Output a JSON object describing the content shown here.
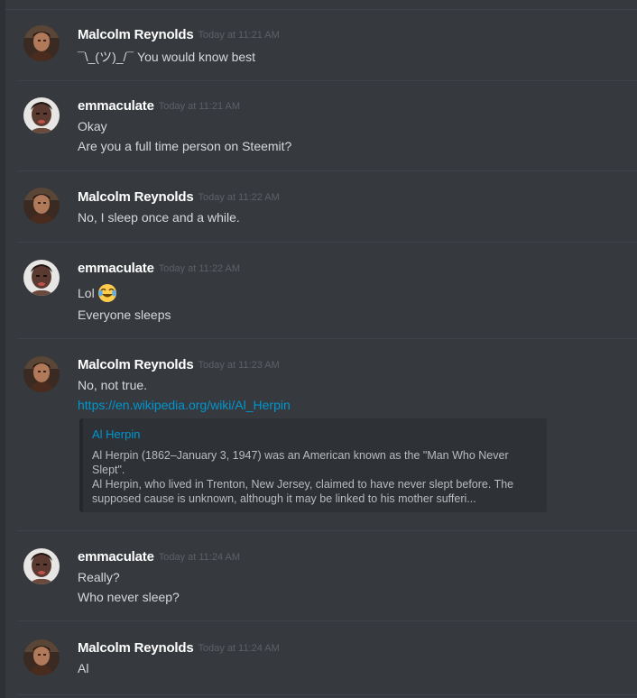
{
  "messages": [
    {
      "author": "Malcolm Reynolds",
      "timestamp": "Today at 11:21 AM",
      "lines": [
        "¯\\_(ツ)_/¯    You would know best"
      ]
    },
    {
      "author": "emmaculate",
      "timestamp": "Today at 11:21 AM",
      "lines": [
        "Okay",
        "Are you a full time person on Steemit?"
      ]
    },
    {
      "author": "Malcolm Reynolds",
      "timestamp": "Today at 11:22 AM",
      "lines": [
        "No, I sleep once and a while."
      ]
    },
    {
      "author": "emmaculate",
      "timestamp": "Today at 11:22 AM",
      "lines": [
        "Lol",
        "Everyone sleeps"
      ],
      "emoji": "joy-emoji"
    },
    {
      "author": "Malcolm Reynolds",
      "timestamp": "Today at 11:23 AM",
      "lines": [
        "No, not true."
      ],
      "link": "https://en.wikipedia.org/wiki/Al_Herpin",
      "embed": {
        "title": "Al Herpin",
        "description_1": "Al Herpin (1862–January 3, 1947) was an American known as the \"Man Who Never Slept\".",
        "description_2": "Al Herpin, who lived in Trenton, New Jersey, claimed to have never slept before. The supposed cause is unknown, although it may be linked to his mother sufferi..."
      }
    },
    {
      "author": "emmaculate",
      "timestamp": "Today at 11:24 AM",
      "lines": [
        "Really?",
        "Who never sleep?"
      ]
    },
    {
      "author": "Malcolm Reynolds",
      "timestamp": "Today at 11:24 AM",
      "lines": [
        "Al"
      ]
    }
  ],
  "icons": {
    "malcolm_avatar": "malcolm-avatar",
    "emmaculate_avatar": "emmaculate-avatar",
    "emoji": "face-with-tears-of-joy"
  },
  "colors": {
    "background": "#36393e",
    "username": "#ffffff",
    "timestamp": "#5d6066",
    "text": "#d7d8da",
    "link": "#0096cf",
    "embed_bg": "#2e3136"
  }
}
